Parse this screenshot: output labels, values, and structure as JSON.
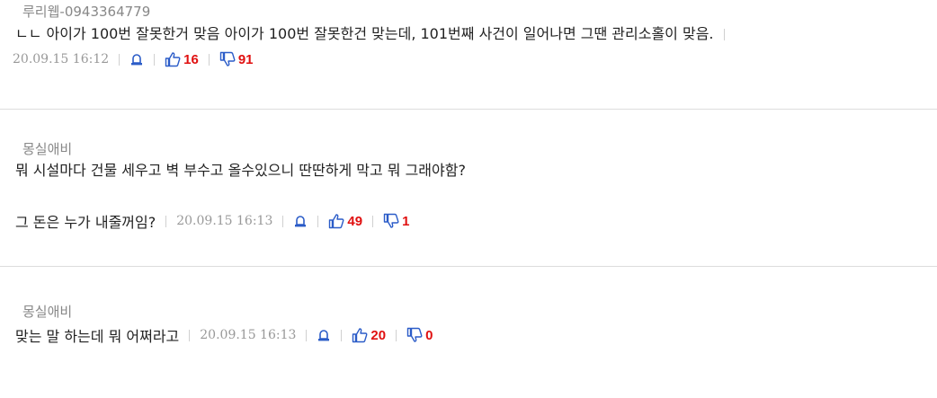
{
  "colors": {
    "icon_blue": "#2b5cc8",
    "count_red": "#e01010",
    "meta_gray": "#999999"
  },
  "comments": [
    {
      "author": "루리웹-0943364779",
      "text": "ㄴㄴ 아이가 100번 잘못한거 맞음 아이가 100번 잘못한건 맞는데, 101번째 사건이 일어나면 그땐 관리소홀이 맞음.",
      "date": "20.09.15 16:12",
      "likes": "16",
      "dislikes": "91",
      "icons": [
        "report-icon",
        "thumbs-up-icon",
        "thumbs-down-icon"
      ]
    },
    {
      "author": "몽실애비",
      "text": "뭐 시설마다 건물 세우고 벽 부수고 올수있으니 딴딴하게 막고 뭐 그래야함?",
      "text2": "그 돈은 누가 내줄꺼임?",
      "date": "20.09.15 16:13",
      "likes": "49",
      "dislikes": "1",
      "icons": [
        "report-icon",
        "thumbs-up-icon",
        "thumbs-down-icon"
      ]
    },
    {
      "author": "몽실애비",
      "text": "맞는 말 하는데 뭐 어쩌라고",
      "date": "20.09.15 16:13",
      "likes": "20",
      "dislikes": "0",
      "icons": [
        "report-icon",
        "thumbs-up-icon",
        "thumbs-down-icon"
      ]
    }
  ]
}
